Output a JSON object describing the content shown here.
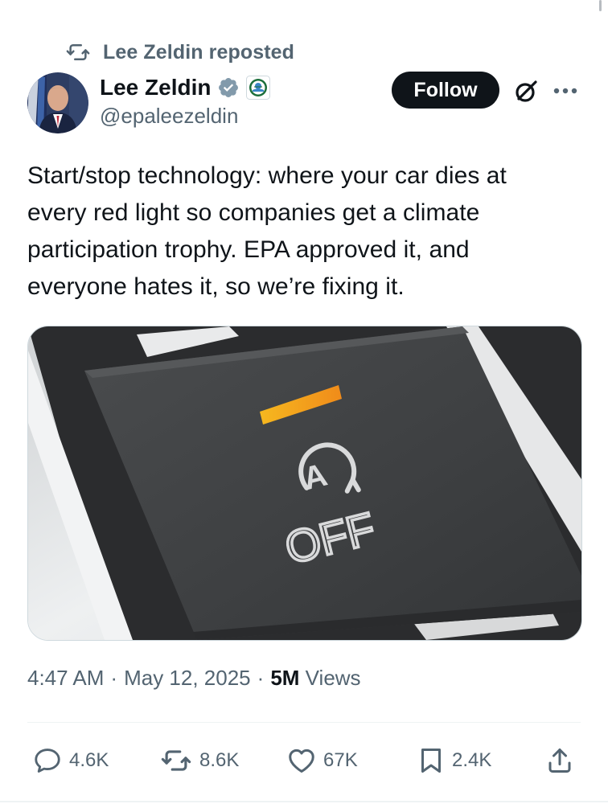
{
  "repost": {
    "icon": "repost-icon",
    "text": "Lee Zeldin reposted"
  },
  "author": {
    "display_name": "Lee Zeldin",
    "handle": "@epaleezeldin",
    "verified_icon": "verified-badge-icon",
    "affiliate_icon": "epa-seal-icon"
  },
  "header": {
    "follow_label": "Follow",
    "grok_icon": "grok-icon",
    "more_icon": "more-options-icon"
  },
  "tweet": {
    "text": "Start/stop technology: where your car dies at\nevery red light so companies get a climate\nparticipation trophy. EPA approved it, and\neveryone hates it, so we’re fixing it.",
    "media": {
      "label_top": "A",
      "label_bottom": "OFF"
    }
  },
  "meta": {
    "time": "4:47 AM",
    "sep1": "·",
    "date": "May 12, 2025",
    "sep2": "·",
    "views_count": "5M",
    "views_label": "Views"
  },
  "actions": {
    "reply": {
      "icon": "reply-icon",
      "count": "4.6K"
    },
    "repost": {
      "icon": "repost-icon",
      "count": "8.6K"
    },
    "like": {
      "icon": "heart-icon",
      "count": "67K"
    },
    "bookmark": {
      "icon": "bookmark-icon",
      "count": "2.4K"
    },
    "share": {
      "icon": "share-icon"
    }
  },
  "colors": {
    "text": "#0f1419",
    "secondary": "#536471",
    "verified": "#829aab",
    "follow_bg": "#0f1419",
    "indicator": "#f2b21c"
  }
}
